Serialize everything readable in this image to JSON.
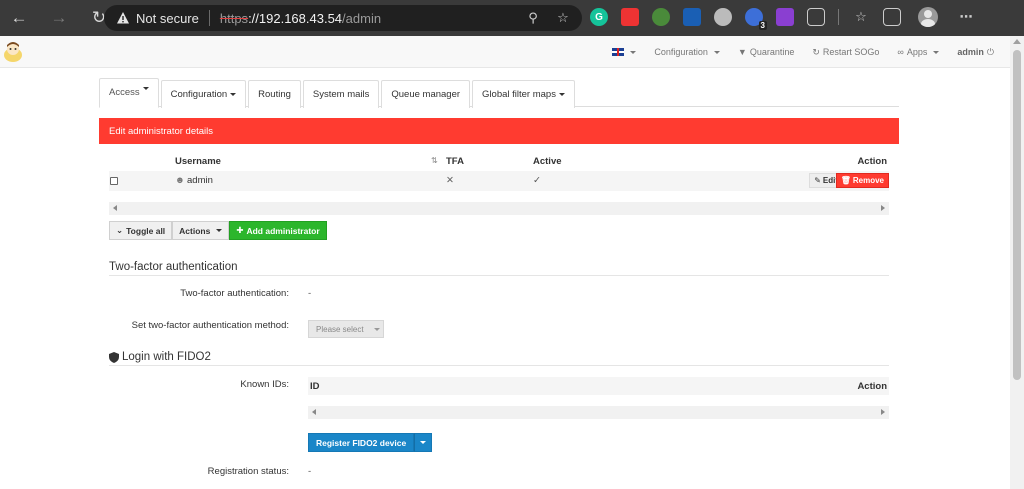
{
  "browser": {
    "security_label": "Not secure",
    "url_scheme": "https",
    "url_host": "://192.168.43.54",
    "url_path": "/admin",
    "extension_badge": "3",
    "extension_letter": "G"
  },
  "topnav": {
    "language_flag": "uk-flag-icon",
    "configuration": "Configuration",
    "quarantine": "Quarantine",
    "restart_sogo": "Restart SOGo",
    "apps": "Apps",
    "user": "admin"
  },
  "tabs": [
    {
      "label": "Access",
      "dropdown": true,
      "active": true
    },
    {
      "label": "Configuration",
      "dropdown": true,
      "active": false
    },
    {
      "label": "Routing",
      "dropdown": false,
      "active": false
    },
    {
      "label": "System mails",
      "dropdown": false,
      "active": false
    },
    {
      "label": "Queue manager",
      "dropdown": false,
      "active": false
    },
    {
      "label": "Global filter maps",
      "dropdown": true,
      "active": false
    }
  ],
  "panel": {
    "heading": "Edit administrator details",
    "heading_color": "#ff3b30"
  },
  "admin_table": {
    "columns": {
      "username": "Username",
      "tfa": "TFA",
      "active": "Active",
      "action": "Action"
    },
    "rows": [
      {
        "username": "admin",
        "tfa": "✕",
        "active": "✓",
        "edit": "Edit",
        "remove": "Remove"
      }
    ]
  },
  "buttons": {
    "toggle_all": "Toggle all",
    "actions": "Actions",
    "add_admin": "Add administrator"
  },
  "tfa_section": {
    "title": "Two-factor authentication",
    "tfa_label": "Two-factor authentication:",
    "tfa_value": "-",
    "method_label": "Set two-factor authentication method:",
    "method_placeholder": "Please select"
  },
  "fido_section": {
    "title": "Login with FIDO2",
    "known_ids_label": "Known IDs:",
    "col_id": "ID",
    "col_action": "Action",
    "register_button": "Register FIDO2 device",
    "status_label": "Registration status:",
    "status_value": "-"
  }
}
